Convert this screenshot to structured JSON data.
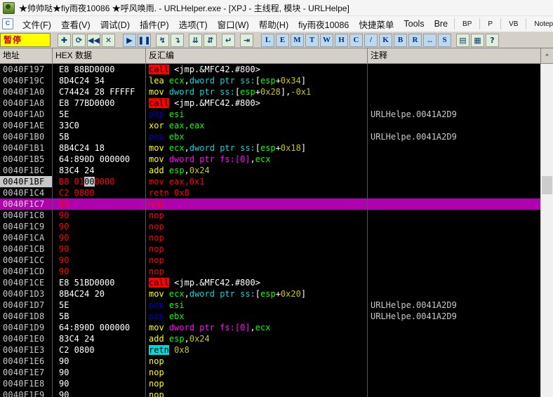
{
  "window": {
    "title": "★帅帅哒★fiy雨夜10086  ★呼风唤雨. - URLHelper.exe - [XPJ -  主线程, 模块 - URLHelpe]",
    "app_icon": "olly-debugger-icon"
  },
  "menu": {
    "logo_glyph": "C",
    "items": [
      {
        "label": "文件(F)"
      },
      {
        "label": "查看(V)"
      },
      {
        "label": "调试(D)"
      },
      {
        "label": "插件(P)"
      },
      {
        "label": "选项(T)"
      },
      {
        "label": "窗口(W)"
      },
      {
        "label": "帮助(H)"
      },
      {
        "label": "fiy雨夜10086"
      },
      {
        "label": "快捷菜单"
      },
      {
        "label": "Tools"
      },
      {
        "label": "Bre"
      }
    ],
    "buttons": [
      {
        "label": "BP"
      },
      {
        "label": "P"
      },
      {
        "label": "VB"
      },
      {
        "label": "Notepad"
      }
    ]
  },
  "toolbar": {
    "status_label": "暂停",
    "status_bg": "#ffff00",
    "status_fg": "#cc0000",
    "group1": [
      {
        "name": "open-module-icon",
        "glyph": "✚"
      },
      {
        "name": "restart-icon",
        "glyph": "⟳"
      },
      {
        "name": "rewind-icon",
        "glyph": "◀◀"
      },
      {
        "name": "close-icon",
        "glyph": "✕"
      }
    ],
    "group2": [
      {
        "name": "run-icon",
        "glyph": "▶"
      },
      {
        "name": "pause-icon",
        "glyph": "❚❚"
      }
    ],
    "group3": [
      {
        "name": "step-into-icon",
        "glyph": "↯"
      },
      {
        "name": "step-over-icon",
        "glyph": "↴"
      }
    ],
    "group4": [
      {
        "name": "trace-into-icon",
        "glyph": "⇊"
      },
      {
        "name": "trace-over-icon",
        "glyph": "⇵"
      }
    ],
    "group5": [
      {
        "name": "execute-till-return-icon",
        "glyph": "↵"
      }
    ],
    "group6": [
      {
        "name": "run-to-selection-icon",
        "glyph": "⇥"
      }
    ],
    "letters": [
      "L",
      "E",
      "M",
      "T",
      "W",
      "H",
      "C",
      "/",
      "K",
      "B",
      "R",
      "...",
      "S"
    ],
    "group7": [
      {
        "name": "options-list-icon",
        "glyph": "▤"
      },
      {
        "name": "appearance-icon",
        "glyph": "▦"
      },
      {
        "name": "help-icon",
        "glyph": "?"
      }
    ]
  },
  "columns": {
    "address": "地址",
    "hex": "HEX 数据",
    "disasm": "反汇编",
    "comment": "注释",
    "scroll_up_glyph": "^"
  },
  "rows": [
    {
      "addr": "0040F197",
      "hex": "E8 88BD0000",
      "comment": "",
      "state": "normal",
      "tokens": [
        {
          "t": "call",
          "c": "call"
        },
        {
          "t": "sp",
          "c": " "
        },
        {
          "t": "w",
          "c": "<jmp.&MFC42.#800>"
        }
      ]
    },
    {
      "addr": "0040F19C",
      "hex": "8D4C24 34",
      "comment": "",
      "state": "normal",
      "tokens": [
        {
          "t": "mn",
          "c": "lea"
        },
        {
          "t": "sp",
          "c": " "
        },
        {
          "t": "reg",
          "c": "ecx"
        },
        {
          "t": "w",
          "c": ","
        },
        {
          "t": "kw",
          "c": "dword ptr ss:"
        },
        {
          "t": "w",
          "c": "["
        },
        {
          "t": "reg",
          "c": "esp"
        },
        {
          "t": "w",
          "c": "+"
        },
        {
          "t": "num",
          "c": "0x34"
        },
        {
          "t": "w",
          "c": "]"
        }
      ]
    },
    {
      "addr": "0040F1A0",
      "hex": "C74424 28 FFFFF",
      "comment": "",
      "state": "normal",
      "tokens": [
        {
          "t": "mn",
          "c": "mov"
        },
        {
          "t": "sp",
          "c": " "
        },
        {
          "t": "kw",
          "c": "dword ptr ss:"
        },
        {
          "t": "w",
          "c": "["
        },
        {
          "t": "reg",
          "c": "esp"
        },
        {
          "t": "w",
          "c": "+"
        },
        {
          "t": "num",
          "c": "0x28"
        },
        {
          "t": "w",
          "c": "],"
        },
        {
          "t": "num",
          "c": "-0x1"
        }
      ]
    },
    {
      "addr": "0040F1A8",
      "hex": "E8 77BD0000",
      "comment": "",
      "state": "normal",
      "tokens": [
        {
          "t": "call",
          "c": "call"
        },
        {
          "t": "sp",
          "c": " "
        },
        {
          "t": "w",
          "c": "<jmp.&MFC42.#800>"
        }
      ]
    },
    {
      "addr": "0040F1AD",
      "hex": "5E",
      "comment": "URLHelpe.0041A2D9",
      "state": "normal",
      "tokens": [
        {
          "t": "pop",
          "c": "pop"
        },
        {
          "t": "sp",
          "c": " "
        },
        {
          "t": "reg",
          "c": "esi"
        }
      ]
    },
    {
      "addr": "0040F1AE",
      "hex": "33C0",
      "comment": "",
      "state": "normal",
      "tokens": [
        {
          "t": "mn",
          "c": "xor"
        },
        {
          "t": "sp",
          "c": " "
        },
        {
          "t": "reg",
          "c": "eax,eax"
        }
      ]
    },
    {
      "addr": "0040F1B0",
      "hex": "5B",
      "comment": "URLHelpe.0041A2D9",
      "state": "normal",
      "tokens": [
        {
          "t": "pop",
          "c": "pop"
        },
        {
          "t": "sp",
          "c": " "
        },
        {
          "t": "reg",
          "c": "ebx"
        }
      ]
    },
    {
      "addr": "0040F1B1",
      "hex": "8B4C24 18",
      "comment": "",
      "state": "normal",
      "tokens": [
        {
          "t": "mn",
          "c": "mov"
        },
        {
          "t": "sp",
          "c": " "
        },
        {
          "t": "reg",
          "c": "ecx"
        },
        {
          "t": "w",
          "c": ","
        },
        {
          "t": "kw",
          "c": "dword ptr ss:"
        },
        {
          "t": "w",
          "c": "["
        },
        {
          "t": "reg",
          "c": "esp"
        },
        {
          "t": "w",
          "c": "+"
        },
        {
          "t": "num",
          "c": "0x18"
        },
        {
          "t": "w",
          "c": "]"
        }
      ]
    },
    {
      "addr": "0040F1B5",
      "hex": "64:890D 000000",
      "comment": "",
      "state": "normal",
      "tokens": [
        {
          "t": "mn",
          "c": "mov"
        },
        {
          "t": "sp",
          "c": " "
        },
        {
          "t": "seg",
          "c": "dword ptr fs:"
        },
        {
          "t": "seg",
          "c": "["
        },
        {
          "t": "seg",
          "c": "0"
        },
        {
          "t": "seg",
          "c": "]"
        },
        {
          "t": "w",
          "c": ","
        },
        {
          "t": "reg",
          "c": "ecx"
        }
      ]
    },
    {
      "addr": "0040F1BC",
      "hex": "83C4 24",
      "comment": "",
      "state": "normal",
      "tokens": [
        {
          "t": "mn",
          "c": "add"
        },
        {
          "t": "sp",
          "c": " "
        },
        {
          "t": "reg",
          "c": "esp"
        },
        {
          "t": "w",
          "c": ","
        },
        {
          "t": "num",
          "c": "0x24"
        }
      ]
    },
    {
      "addr": "0040F1BF",
      "hex": "B8 01000000",
      "hex_sel": "00",
      "comment": "",
      "state": "eip-modified",
      "tokens": [
        {
          "t": "mnr",
          "c": "mov"
        },
        {
          "t": "sp",
          "c": " "
        },
        {
          "t": "mnr",
          "c": "eax,0x1"
        }
      ]
    },
    {
      "addr": "0040F1C4",
      "hex": "C2 0800",
      "comment": "",
      "state": "modified",
      "tokens": [
        {
          "t": "mnr",
          "c": "retn"
        },
        {
          "t": "sp",
          "c": " "
        },
        {
          "t": "mnr",
          "c": "0x8"
        }
      ]
    },
    {
      "addr": "0040F1C7",
      "hex": "90",
      "comment": "",
      "state": "selected-modified",
      "tokens": [
        {
          "t": "nopr",
          "c": "nop"
        }
      ]
    },
    {
      "addr": "0040F1C8",
      "hex": "90",
      "comment": "",
      "state": "modified",
      "tokens": [
        {
          "t": "nopr",
          "c": "nop"
        }
      ]
    },
    {
      "addr": "0040F1C9",
      "hex": "90",
      "comment": "",
      "state": "modified",
      "tokens": [
        {
          "t": "nopr",
          "c": "nop"
        }
      ]
    },
    {
      "addr": "0040F1CA",
      "hex": "90",
      "comment": "",
      "state": "modified",
      "tokens": [
        {
          "t": "nopr",
          "c": "nop"
        }
      ]
    },
    {
      "addr": "0040F1CB",
      "hex": "90",
      "comment": "",
      "state": "modified",
      "tokens": [
        {
          "t": "nopr",
          "c": "nop"
        }
      ]
    },
    {
      "addr": "0040F1CC",
      "hex": "90",
      "comment": "",
      "state": "modified",
      "tokens": [
        {
          "t": "nopr",
          "c": "nop"
        }
      ]
    },
    {
      "addr": "0040F1CD",
      "hex": "90",
      "comment": "",
      "state": "modified",
      "tokens": [
        {
          "t": "nopr",
          "c": "nop"
        }
      ]
    },
    {
      "addr": "0040F1CE",
      "hex": "E8 51BD0000",
      "comment": "",
      "state": "normal",
      "tokens": [
        {
          "t": "call",
          "c": "call"
        },
        {
          "t": "sp",
          "c": " "
        },
        {
          "t": "w",
          "c": "<jmp.&MFC42.#800>"
        }
      ]
    },
    {
      "addr": "0040F1D3",
      "hex": "8B4C24 20",
      "comment": "",
      "state": "normal",
      "tokens": [
        {
          "t": "mn",
          "c": "mov"
        },
        {
          "t": "sp",
          "c": " "
        },
        {
          "t": "reg",
          "c": "ecx"
        },
        {
          "t": "w",
          "c": ","
        },
        {
          "t": "kw",
          "c": "dword ptr ss:"
        },
        {
          "t": "w",
          "c": "["
        },
        {
          "t": "reg",
          "c": "esp"
        },
        {
          "t": "w",
          "c": "+"
        },
        {
          "t": "num",
          "c": "0x20"
        },
        {
          "t": "w",
          "c": "]"
        }
      ]
    },
    {
      "addr": "0040F1D7",
      "hex": "5E",
      "comment": "URLHelpe.0041A2D9",
      "state": "normal",
      "tokens": [
        {
          "t": "pop",
          "c": "pop"
        },
        {
          "t": "sp",
          "c": " "
        },
        {
          "t": "reg",
          "c": "esi"
        }
      ]
    },
    {
      "addr": "0040F1D8",
      "hex": "5B",
      "comment": "URLHelpe.0041A2D9",
      "state": "normal",
      "tokens": [
        {
          "t": "pop",
          "c": "pop"
        },
        {
          "t": "sp",
          "c": " "
        },
        {
          "t": "reg",
          "c": "ebx"
        }
      ]
    },
    {
      "addr": "0040F1D9",
      "hex": "64:890D 000000",
      "comment": "",
      "state": "normal",
      "tokens": [
        {
          "t": "mn",
          "c": "mov"
        },
        {
          "t": "sp",
          "c": " "
        },
        {
          "t": "seg",
          "c": "dword ptr fs:"
        },
        {
          "t": "seg",
          "c": "["
        },
        {
          "t": "seg",
          "c": "0"
        },
        {
          "t": "seg",
          "c": "]"
        },
        {
          "t": "w",
          "c": ","
        },
        {
          "t": "reg",
          "c": "ecx"
        }
      ]
    },
    {
      "addr": "0040F1E0",
      "hex": "83C4 24",
      "comment": "",
      "state": "normal",
      "tokens": [
        {
          "t": "mn",
          "c": "add"
        },
        {
          "t": "sp",
          "c": " "
        },
        {
          "t": "reg",
          "c": "esp"
        },
        {
          "t": "w",
          "c": ","
        },
        {
          "t": "num",
          "c": "0x24"
        }
      ]
    },
    {
      "addr": "0040F1E3",
      "hex": "C2 0800",
      "comment": "",
      "state": "normal",
      "tokens": [
        {
          "t": "retnhl",
          "c": "retn"
        },
        {
          "t": "sp",
          "c": " "
        },
        {
          "t": "num",
          "c": "0x8"
        }
      ]
    },
    {
      "addr": "0040F1E6",
      "hex": "90",
      "comment": "",
      "state": "normal",
      "tokens": [
        {
          "t": "nop",
          "c": "nop"
        }
      ]
    },
    {
      "addr": "0040F1E7",
      "hex": "90",
      "comment": "",
      "state": "normal",
      "tokens": [
        {
          "t": "nop",
          "c": "nop"
        }
      ]
    },
    {
      "addr": "0040F1E8",
      "hex": "90",
      "comment": "",
      "state": "normal",
      "tokens": [
        {
          "t": "nop",
          "c": "nop"
        }
      ]
    },
    {
      "addr": "0040F1E9",
      "hex": "90",
      "comment": "",
      "state": "normal",
      "tokens": [
        {
          "t": "nop",
          "c": "nop"
        }
      ]
    }
  ]
}
